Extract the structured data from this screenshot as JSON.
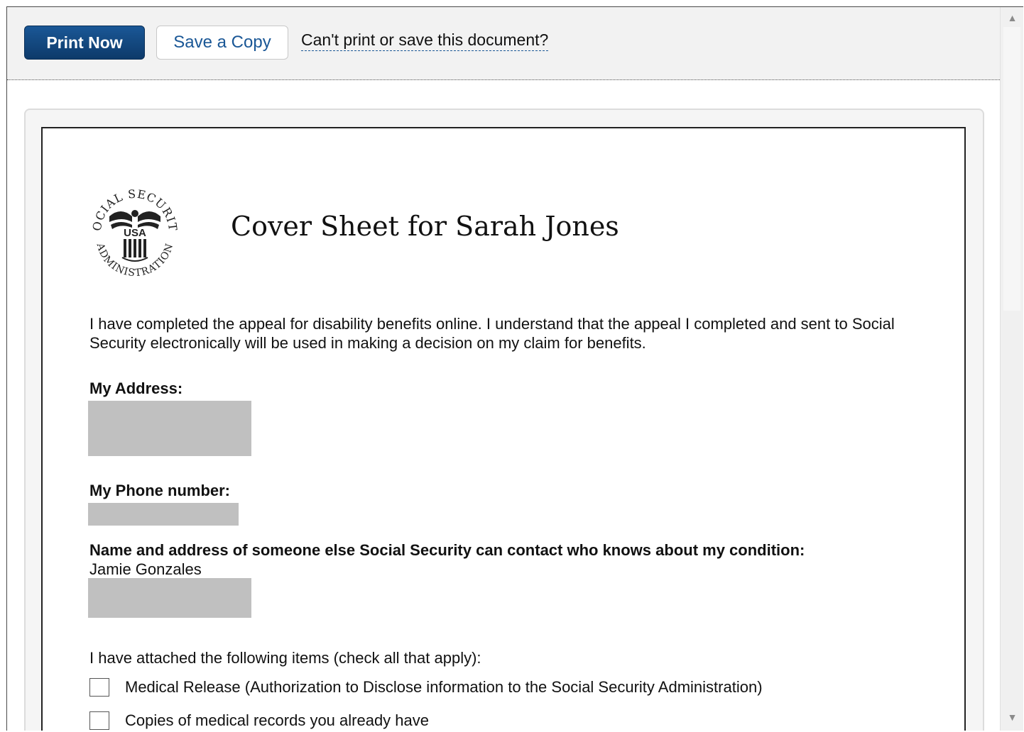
{
  "toolbar": {
    "print_label": "Print Now",
    "save_label": "Save a Copy",
    "help_link": "Can't print or save this document?"
  },
  "document": {
    "title": "Cover Sheet for Sarah Jones",
    "seal": {
      "top_text": "SOCIAL SECURITY",
      "bottom_text": "ADMINISTRATION",
      "center_text": "USA"
    },
    "intro": "I have completed the appeal for disability benefits online. I understand that the appeal I completed and sent to Social Security electronically will be used in making a decision on my claim for benefits.",
    "address_label": "My Address:",
    "phone_label": "My Phone number:",
    "contact_label": "Name and address of someone else Social Security can contact who knows about my condition:",
    "contact_name": "Jamie Gonzales",
    "attach_intro": "I have attached the following items (check all that apply):",
    "attachments": [
      {
        "label": "Medical Release (Authorization to Disclose information to the Social Security Administration)",
        "checked": false
      },
      {
        "label": "Copies of medical records you already have",
        "checked": false
      }
    ]
  },
  "icons": {
    "scroll_up": "up-arrow-icon",
    "scroll_down": "down-arrow-icon",
    "seal": "ssa-seal-icon"
  },
  "colors": {
    "primary_button": "#0d3a6a",
    "link": "#1a5796",
    "redaction": "#c0c0c0"
  }
}
